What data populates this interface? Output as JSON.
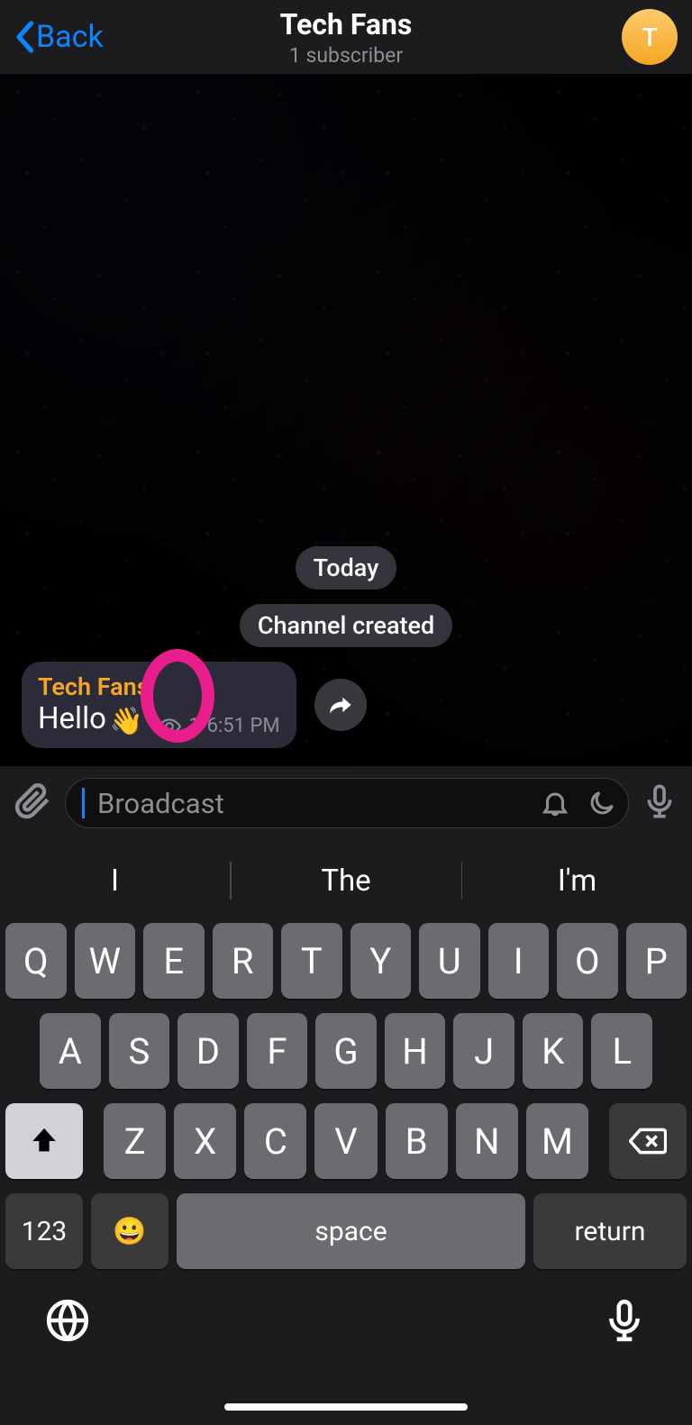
{
  "header": {
    "back_label": "Back",
    "title": "Tech Fans",
    "subtitle": "1 subscriber",
    "avatar_letter": "T"
  },
  "chat": {
    "date_label": "Today",
    "system_message": "Channel created",
    "message": {
      "sender": "Tech Fans",
      "text": "Hello",
      "emoji": "👋",
      "views": "1",
      "time": "6:51 PM"
    }
  },
  "input": {
    "placeholder": "Broadcast"
  },
  "keyboard": {
    "suggestions": [
      "I",
      "The",
      "I'm"
    ],
    "row1": [
      "Q",
      "W",
      "E",
      "R",
      "T",
      "Y",
      "U",
      "I",
      "O",
      "P"
    ],
    "row2": [
      "A",
      "S",
      "D",
      "F",
      "G",
      "H",
      "J",
      "K",
      "L"
    ],
    "row3": [
      "Z",
      "X",
      "C",
      "V",
      "B",
      "N",
      "M"
    ],
    "num_key": "123",
    "space_label": "space",
    "return_label": "return"
  }
}
